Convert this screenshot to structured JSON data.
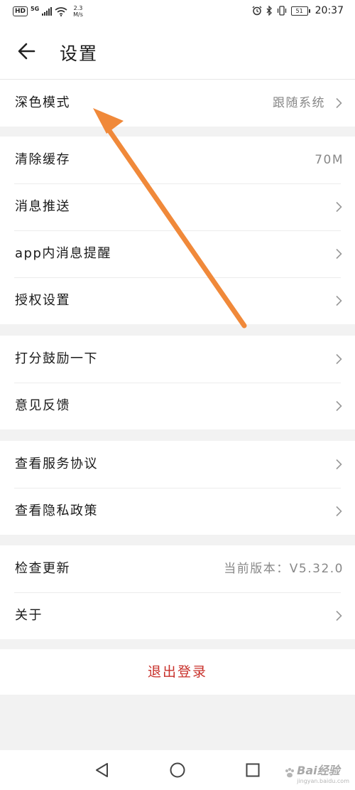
{
  "status_bar": {
    "hd": "HD",
    "network": "5G",
    "speed_value": "2.3",
    "speed_unit": "M/s",
    "battery": "51",
    "time": "20:37"
  },
  "header": {
    "title": "设置"
  },
  "groups": [
    [
      {
        "label": "深色模式",
        "value": "跟随系统",
        "arrow": true
      }
    ],
    [
      {
        "label": "清除缓存",
        "value": "70M",
        "arrow": false
      },
      {
        "label": "消息推送",
        "value": "",
        "arrow": true
      },
      {
        "label": "app内消息提醒",
        "value": "",
        "arrow": true
      },
      {
        "label": "授权设置",
        "value": "",
        "arrow": true
      }
    ],
    [
      {
        "label": "打分鼓励一下",
        "value": "",
        "arrow": true
      },
      {
        "label": "意见反馈",
        "value": "",
        "arrow": true
      }
    ],
    [
      {
        "label": "查看服务协议",
        "value": "",
        "arrow": true
      },
      {
        "label": "查看隐私政策",
        "value": "",
        "arrow": true
      }
    ],
    [
      {
        "label": "检查更新",
        "value": "当前版本：V5.32.0",
        "arrow": false
      },
      {
        "label": "关于",
        "value": "",
        "arrow": true
      }
    ]
  ],
  "logout_label": "退出登录",
  "watermark": {
    "main": "Bai经验",
    "sub": "jingyan.baidu.com"
  },
  "colors": {
    "background": "#f2f2f2",
    "logout": "#c8302a",
    "annotation_arrow": "#f0893a"
  }
}
